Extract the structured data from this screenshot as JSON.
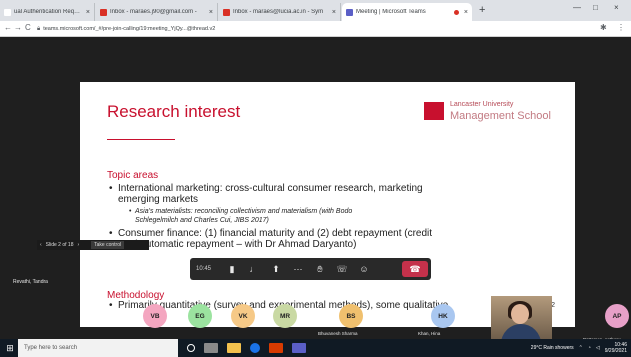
{
  "browser": {
    "tabs": [
      {
        "title": "ual Authentication Requeste",
        "icon_color": "#ffffff",
        "close": "×"
      },
      {
        "title": "Inbox - maraes.j90@gmail.com -",
        "icon_color": "#d93025",
        "close": "×"
      },
      {
        "title": "Inbox - maraes@lucia.ac.in - Sym",
        "icon_color": "#d93025",
        "close": "×"
      },
      {
        "title": "Meeting | Microsoft Teams",
        "icon_color": "#5b5fc7",
        "close": "×",
        "active": true
      }
    ],
    "new_tab": "+",
    "back": "←",
    "forward": "→",
    "reload": "C",
    "url": "teams.microsoft.com/_#/pre-join-calling/19:meeting_YjQy...@thread.v2",
    "window_controls": [
      "—",
      "□",
      "×"
    ]
  },
  "slide": {
    "title": "Research interest",
    "logo": {
      "university": "Lancaster University",
      "school": "Management School"
    },
    "topic_heading": "Topic areas",
    "bullets": [
      {
        "line1": "International marketing: cross-cultural consumer research, marketing",
        "line2": "emerging markets"
      },
      {
        "line1": "Consumer finance: (1) financial maturity and (2) debt repayment (credit",
        "line2": "card automatic repayment – with Dr Ahmad Daryanto)"
      }
    ],
    "sub_bullet": {
      "line1": "Asia's materialists: reconciling collectivism and materialism (with Bodo",
      "line2": "Schlegelmilch and Charles Cui, JIBS 2017)"
    },
    "method_heading": "Methodology",
    "method_bullet": "Primarily quantitative (survey and experimental methods), some qualitative",
    "page_number": "2"
  },
  "pager": {
    "prev": "‹",
    "text": "Slide 2 of 18",
    "next": "›",
    "control": "Take control"
  },
  "call": {
    "time": "10:45",
    "buttons": [
      "camera-icon",
      "mic-icon",
      "share-icon",
      "more-icon",
      "raise-hand-icon",
      "chat-icon",
      "participants-icon"
    ],
    "hangup": "hang-up-icon"
  },
  "presenter_label": "Revathi, Tandra",
  "participants": [
    {
      "initials": "VB",
      "color": "#f4a6c0",
      "name": ""
    },
    {
      "initials": "EG",
      "color": "#9be39f",
      "name": ""
    },
    {
      "initials": "VK",
      "color": "#f6c987",
      "name": ""
    },
    {
      "initials": "MR",
      "color": "#c9d9a3",
      "name": ""
    },
    {
      "initials": "BS",
      "color": "#f0c06e",
      "name": "Bhuvanesh Sharma"
    },
    {
      "initials": "HK",
      "color": "#a9c7f0",
      "name": "Khan, Hina"
    },
    {
      "initials": "AP",
      "color": "#e7a0c8",
      "name": "Patterson, Anthony"
    }
  ],
  "video_name": "Revathi, Tandra",
  "taskbar": {
    "start": "⊞",
    "search_placeholder": "Type here to search",
    "weather": "29°C  Rain showers",
    "time": "10:46",
    "date": "9/29/2021"
  }
}
